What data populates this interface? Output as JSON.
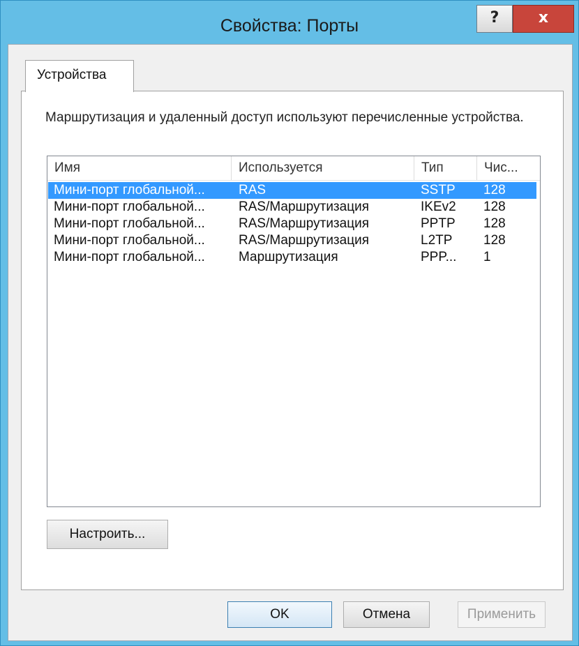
{
  "window": {
    "title": "Свойства: Порты",
    "help_glyph": "?",
    "close_glyph": "x"
  },
  "tabs": [
    {
      "label": "Устройства"
    }
  ],
  "description": "Маршрутизация и удаленный доступ используют перечисленные устройства.",
  "list": {
    "columns": [
      "Имя",
      "Используется",
      "Тип",
      "Чис..."
    ],
    "rows": [
      {
        "name": "Мини-порт глобальной...",
        "used": "RAS",
        "type": "SSTP",
        "count": "128",
        "selected": true
      },
      {
        "name": "Мини-порт глобальной...",
        "used": "RAS/Маршрутизация",
        "type": "IKEv2",
        "count": "128",
        "selected": false
      },
      {
        "name": "Мини-порт глобальной...",
        "used": "RAS/Маршрутизация",
        "type": "PPTP",
        "count": "128",
        "selected": false
      },
      {
        "name": "Мини-порт глобальной...",
        "used": "RAS/Маршрутизация",
        "type": "L2TP",
        "count": "128",
        "selected": false
      },
      {
        "name": "Мини-порт глобальной...",
        "used": "Маршрутизация",
        "type": "PPP...",
        "count": "1",
        "selected": false
      }
    ]
  },
  "buttons": {
    "configure": "Настроить...",
    "ok": "OK",
    "cancel": "Отмена",
    "apply": "Применить"
  },
  "colors": {
    "titlebar": "#64bee6",
    "selection": "#3399ff",
    "close": "#c8453b"
  }
}
